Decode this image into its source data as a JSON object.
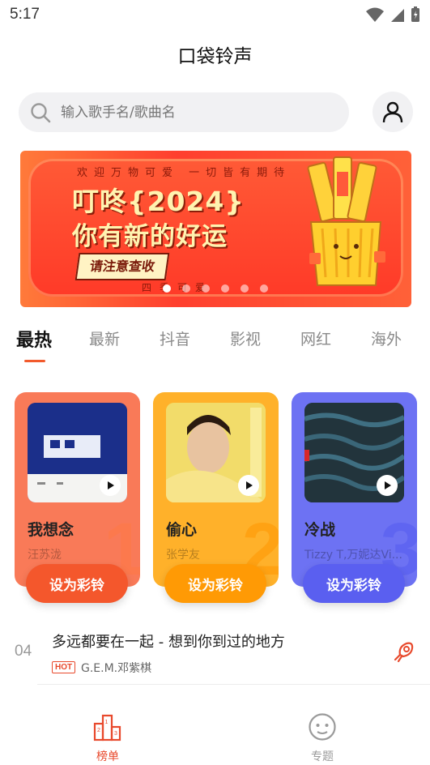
{
  "status_bar": {
    "time": "5:17"
  },
  "app": {
    "title": "口袋铃声"
  },
  "search": {
    "placeholder": "输入歌手名/歌曲名"
  },
  "banner": {
    "top_text": "欢迎万物可爱 一切皆有期待",
    "line1": "叮咚{2024}",
    "line2": "你有新的好运",
    "cta": "请注意查收",
    "bottom_text": "四季可爱",
    "slide_count": 6,
    "active_slide": 1
  },
  "tabs": [
    {
      "label": "最热",
      "active": true
    },
    {
      "label": "最新",
      "active": false
    },
    {
      "label": "抖音",
      "active": false
    },
    {
      "label": "影视",
      "active": false
    },
    {
      "label": "网红",
      "active": false
    },
    {
      "label": "海外",
      "active": false
    }
  ],
  "top_cards": [
    {
      "rank": "1",
      "title": "我想念",
      "artist": "汪苏泷",
      "button": "设为彩铃",
      "card_color": "#f97a58",
      "button_color": "#f4572c",
      "rank_color": "rgba(255,120,70,0.55)"
    },
    {
      "rank": "2",
      "title": "偷心",
      "artist": "张学友",
      "button": "设为彩铃",
      "card_color": "#ffb12a",
      "button_color": "#ff9a05",
      "rank_color": "rgba(255,150,0,0.55)"
    },
    {
      "rank": "3",
      "title": "冷战",
      "artist": "Tizzy T,万妮达Vi...",
      "button": "设为彩铃",
      "card_color": "#6d72f3",
      "button_color": "#5a5ff0",
      "rank_color": "rgba(90,95,240,0.7)"
    }
  ],
  "list": [
    {
      "index": "04",
      "title": "多远都要在一起 - 想到你到过的地方",
      "badge": "HOT",
      "artist": "G.E.M.邓紫棋"
    }
  ],
  "bottom_nav": [
    {
      "label": "榜单",
      "icon": "podium-icon",
      "active": true
    },
    {
      "label": "专题",
      "icon": "smiley-icon",
      "active": false
    }
  ],
  "colors": {
    "accent": "#f25a2c",
    "inactive": "#9a9a9a"
  }
}
